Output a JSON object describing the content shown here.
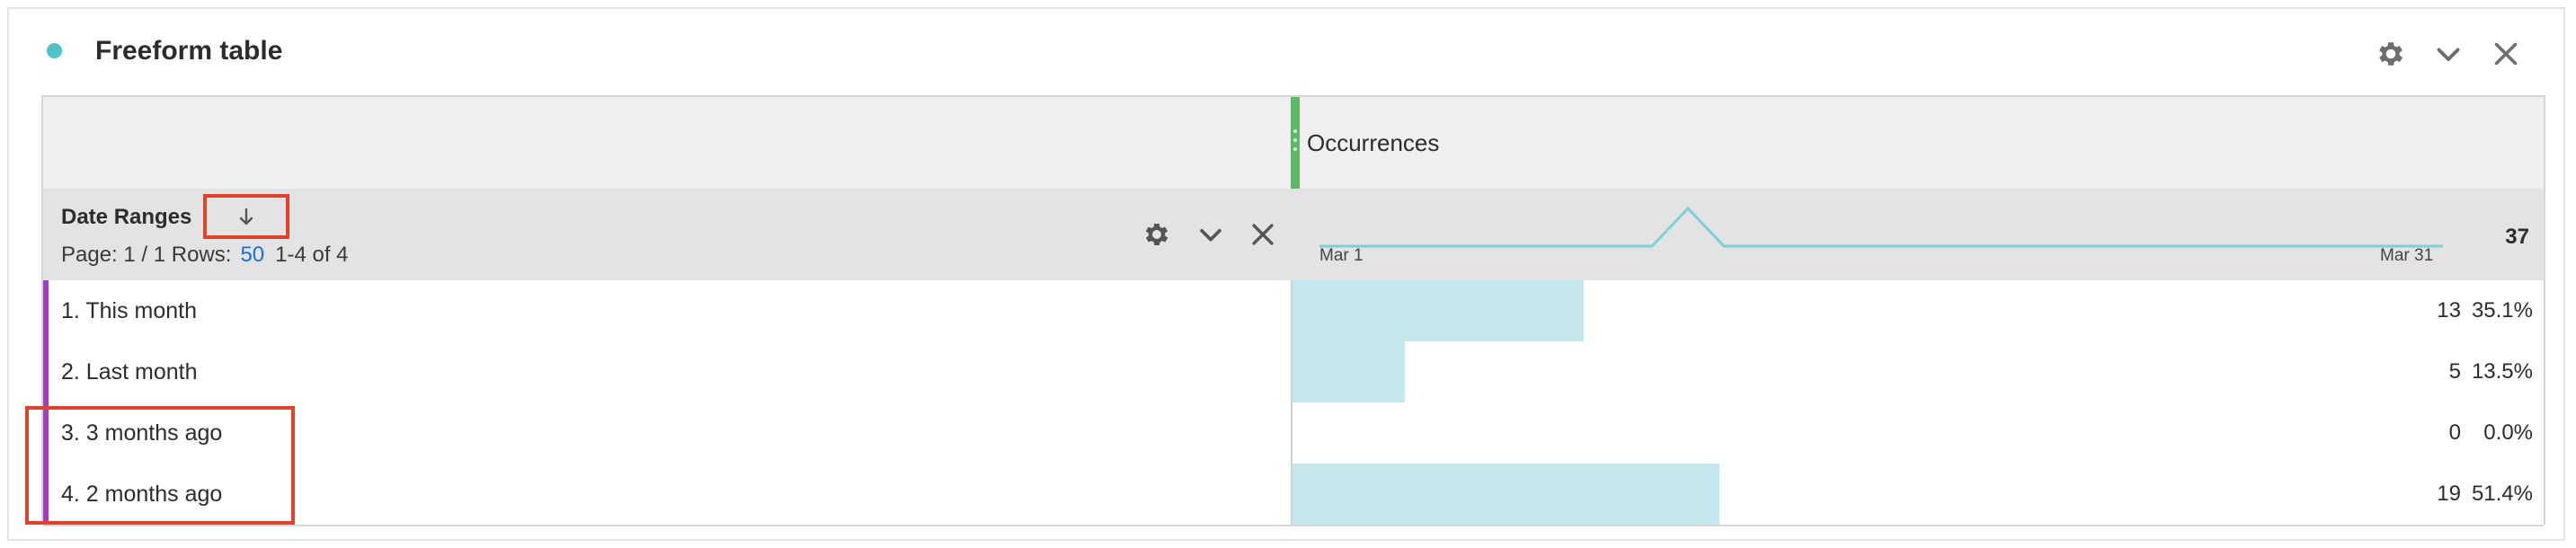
{
  "panel": {
    "title": "Freeform table",
    "status_color": "#4fc3c9"
  },
  "table": {
    "metric": {
      "name": "Occurrences",
      "total": "37",
      "handle_color": "#5fb865"
    },
    "dimension": {
      "title": "Date Ranges",
      "sort_icon": "arrow-down-icon",
      "pager_prefix": "Page: 1 / 1 Rows:",
      "rows_per_page": "50",
      "range_text": "1-4 of 4"
    },
    "sparkline": {
      "start_label": "Mar 1",
      "end_label": "Mar 31",
      "color": "#7fcfd6"
    },
    "rows": [
      {
        "label": "1.  This month",
        "count": "13",
        "percent": "35.1%",
        "share": 0.351
      },
      {
        "label": "2.  Last month",
        "count": "5",
        "percent": "13.5%",
        "share": 0.135
      },
      {
        "label": "3.  3 months ago",
        "count": "0",
        "percent": "0.0%",
        "share": 0.0
      },
      {
        "label": "4.  2 months ago",
        "count": "19",
        "percent": "51.4%",
        "share": 0.514
      }
    ],
    "row_accent_color": "#a23fbf",
    "bar_color": "#c5e8ec",
    "highlight_color": "#e0422b"
  }
}
